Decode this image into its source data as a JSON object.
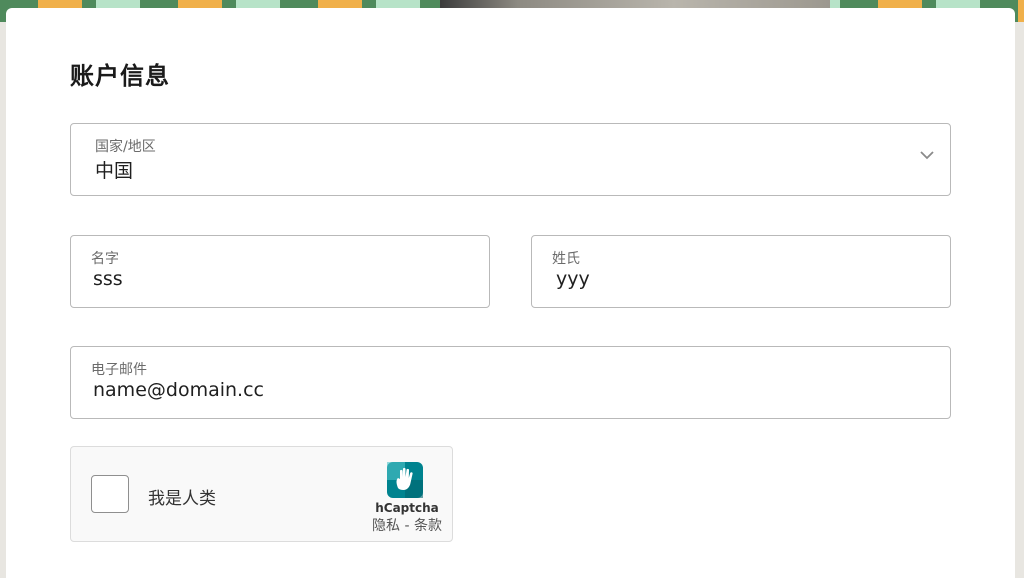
{
  "section": {
    "title": "账户信息"
  },
  "country": {
    "label": "国家/地区",
    "value": "中国"
  },
  "first_name": {
    "label": "名字",
    "value": "sss"
  },
  "last_name": {
    "label": "姓氏",
    "value": "yyy"
  },
  "email": {
    "label": "电子邮件",
    "value": "name@domain.cc"
  },
  "captcha": {
    "checkbox_label": "我是人类",
    "brand": "hCaptcha",
    "links": "隐私 - 条款",
    "accent": "#00838f"
  },
  "colors": {
    "border": "#b9b9b9",
    "title": "#1a1a1a",
    "label": "#6b6b6b"
  }
}
